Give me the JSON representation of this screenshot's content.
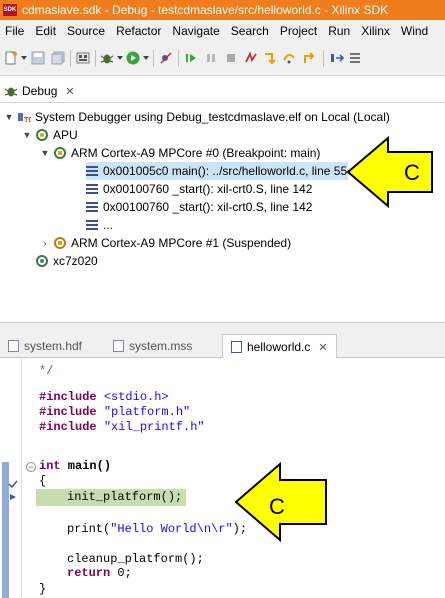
{
  "window": {
    "sdk_badge": "SDK",
    "title": "cdmaslave.sdk - Debug - testcdmaslave/src/helloworld.c - Xilinx SDK"
  },
  "menubar": {
    "items": [
      "File",
      "Edit",
      "Source",
      "Refactor",
      "Navigate",
      "Search",
      "Project",
      "Run",
      "Xilinx",
      "Wind"
    ]
  },
  "debug_view": {
    "tab_label": "Debug",
    "tab_close": "✕",
    "tree": {
      "session": "System Debugger using Debug_testcdmaslave.elf on Local (Local)",
      "apu": "APU",
      "core0": "ARM Cortex-A9 MPCore #0 (Breakpoint: main)",
      "frames": [
        "0x001005c0 main(): ../src/helloworld.c, line 55",
        "0x00100760 _start(): xil-crt0.S, line 142",
        "0x00100760 _start(): xil-crt0.S, line 142",
        "..."
      ],
      "core1": "ARM Cortex-A9 MPCore #1 (Suspended)",
      "device": "xc7z020"
    }
  },
  "editor_tabs": [
    {
      "label": "system.hdf",
      "active": false
    },
    {
      "label": "system.mss",
      "active": false
    },
    {
      "label": "helloworld.c",
      "active": true,
      "close": "✕"
    }
  ],
  "code": {
    "comment_end": "*/",
    "includes": [
      {
        "directive": "#include",
        "file": "<stdio.h>"
      },
      {
        "directive": "#include",
        "file": "\"platform.h\""
      },
      {
        "directive": "#include",
        "file": "\"xil_printf.h\""
      }
    ],
    "main_kw": "int",
    "main_sig": " main()",
    "open_brace": "{",
    "line_init": "init_platform();",
    "line_print_fn": "print(",
    "line_print_str": "\"Hello World\\n\\r\"",
    "line_print_end": ");",
    "line_cleanup": "cleanup_platform();",
    "return_kw": "return",
    "return_val": " 0;",
    "close_brace": "}"
  },
  "callouts": {
    "label": "C",
    "color": "#ffff00"
  },
  "colors": {
    "titlebar": "#f07d1c",
    "selection": "#cce4f7",
    "current_line": "#c8ddae",
    "keyword": "#7f0055",
    "string": "#2a00ff"
  }
}
